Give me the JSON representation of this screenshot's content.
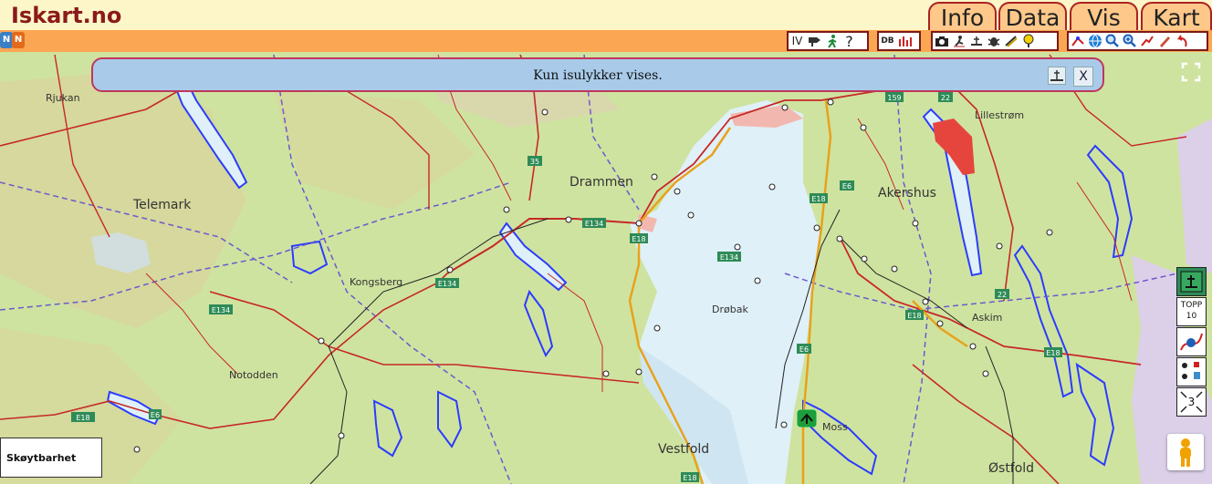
{
  "app": {
    "logo": "Iskart.no"
  },
  "menu": {
    "tabs": [
      "Info",
      "Data",
      "Vis",
      "Kart"
    ]
  },
  "toolbar": {
    "lang": [
      "N",
      "N"
    ],
    "group1": [
      "IV",
      "?"
    ],
    "group2_db": "DB"
  },
  "notice": {
    "text": "Kun isulykker vises.",
    "close": "X"
  },
  "sidepanel": {
    "topp_label": "TOPP",
    "topp_value": "10",
    "count": "3"
  },
  "legend": {
    "label": "Skøytbarhet"
  },
  "map": {
    "places": [
      {
        "name": "Rjukan"
      },
      {
        "name": "Telemark"
      },
      {
        "name": "Drammen"
      },
      {
        "name": "Kongsberg"
      },
      {
        "name": "Notodden"
      },
      {
        "name": "Drøbak"
      },
      {
        "name": "Akershus"
      },
      {
        "name": "Lillestrøm"
      },
      {
        "name": "Askim"
      },
      {
        "name": "Moss"
      },
      {
        "name": "Vestfold"
      },
      {
        "name": "Østfold"
      }
    ],
    "road_labels": [
      "35",
      "E134",
      "E134",
      "E134",
      "E18",
      "E134",
      "E6",
      "E18",
      "E6",
      "E18",
      "E18",
      "E18",
      "22",
      "22",
      "159",
      "E6",
      "E18"
    ]
  },
  "colors": {
    "header_bg": "#fdf6c8",
    "toolbar_bg": "#fba652",
    "logo": "#8b1a1a",
    "notice_bg": "#a9cbe9",
    "notice_border": "#c0365c",
    "lake_marked": "#2b3cff",
    "water": "#dff0f8",
    "land": "#cfe3a0"
  }
}
